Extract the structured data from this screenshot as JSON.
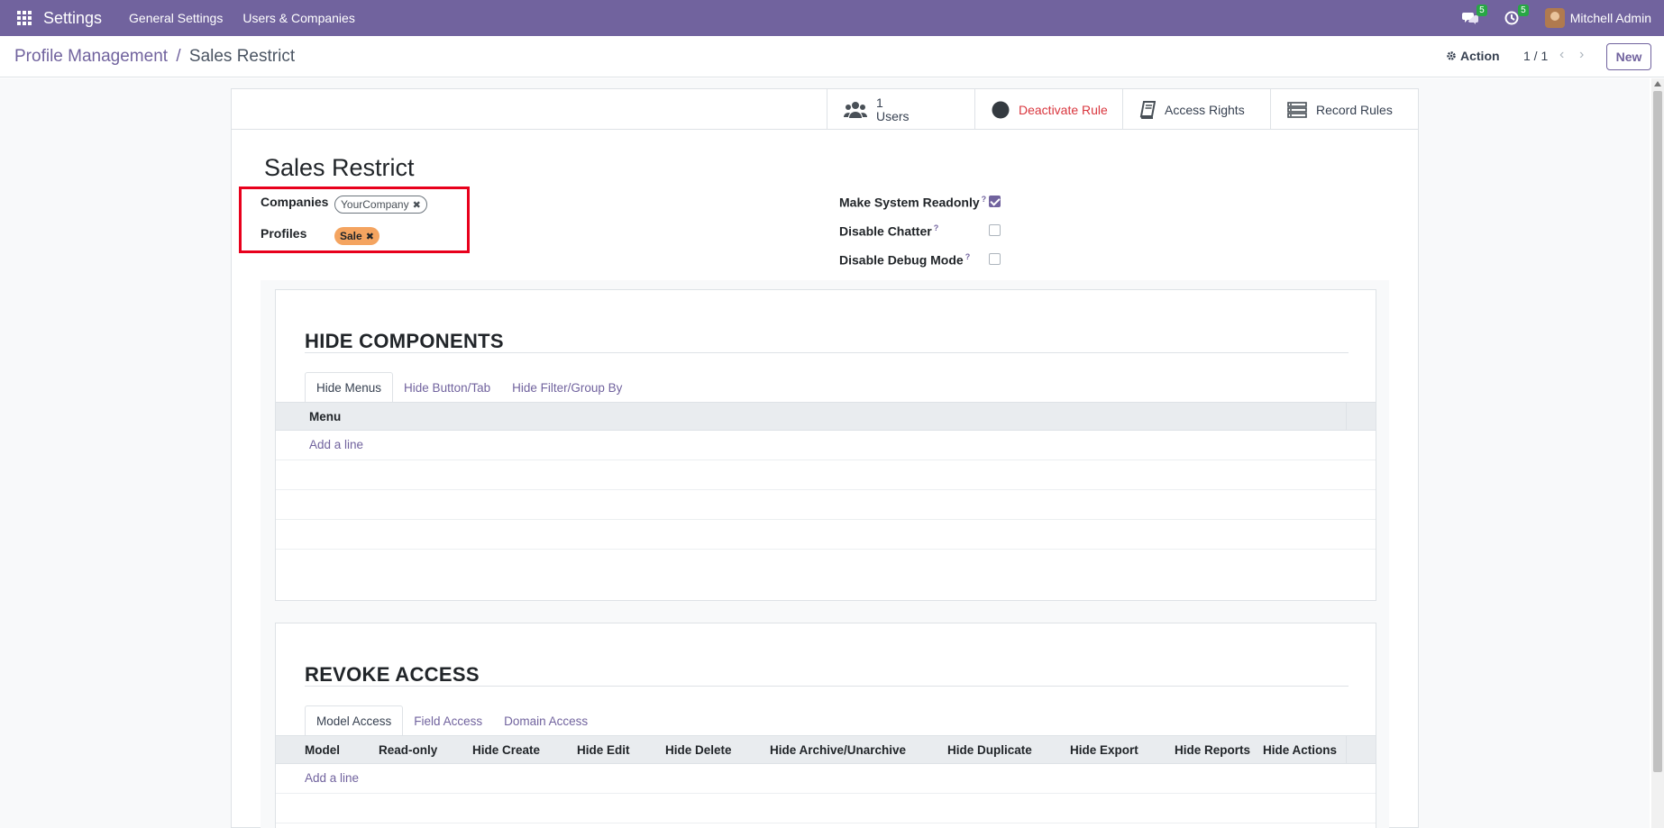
{
  "navbar": {
    "app_title": "Settings",
    "menu": [
      "General Settings",
      "Users & Companies"
    ],
    "messages_count": "5",
    "activities_count": "5",
    "user_name": "Mitchell Admin"
  },
  "control_panel": {
    "breadcrumb_parent": "Profile Management",
    "breadcrumb_sep": "/",
    "breadcrumb_current": "Sales Restrict",
    "action_label": "Action",
    "pager": "1 / 1",
    "new_label": "New"
  },
  "stat_buttons": {
    "users_count": "1",
    "users_label": "Users",
    "deactivate_label": "Deactivate Rule",
    "access_rights_label": "Access Rights",
    "record_rules_label": "Record Rules"
  },
  "record": {
    "title": "Sales Restrict",
    "companies_label": "Companies",
    "company_tag": "YourCompany",
    "profiles_label": "Profiles",
    "profile_tag": "Sale",
    "readonly_label": "Make System Readonly",
    "readonly_checked": true,
    "chatter_label": "Disable Chatter",
    "chatter_checked": false,
    "debug_label": "Disable Debug Mode",
    "debug_checked": false,
    "help_mark": "?"
  },
  "hide_components": {
    "title": "HIDE COMPONENTS",
    "tabs": [
      "Hide Menus",
      "Hide Button/Tab",
      "Hide Filter/Group By"
    ],
    "column": "Menu",
    "add_line": "Add a line"
  },
  "revoke_access": {
    "title": "REVOKE ACCESS",
    "tabs": [
      "Model Access",
      "Field Access",
      "Domain Access"
    ],
    "columns": [
      "Model",
      "Read-only",
      "Hide Create",
      "Hide Edit",
      "Hide Delete",
      "Hide Archive/Unarchive",
      "Hide Duplicate",
      "Hide Export",
      "Hide Reports",
      "Hide Actions"
    ],
    "add_line": "Add a line"
  },
  "colors": {
    "brand": "#71639e",
    "danger": "#d9363e",
    "highlight": "#e8001c",
    "tag_sale": "#f4a460"
  }
}
